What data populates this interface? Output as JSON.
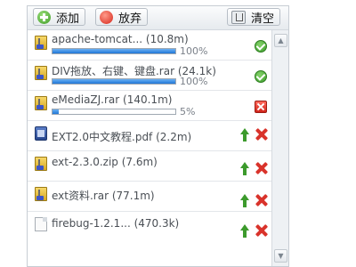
{
  "toolbar": {
    "add_label": "添加",
    "abandon_label": "放弃",
    "clear_label": "清空"
  },
  "files": [
    {
      "name": "apache-tomcat... (10.8m)",
      "type": "zip",
      "progress": 100,
      "percent_text": "100%",
      "status": "complete"
    },
    {
      "name": "DIV拖放、右键、键盘.rar (24.1k)",
      "type": "zip",
      "progress": 100,
      "percent_text": "100%",
      "status": "complete"
    },
    {
      "name": "eMediaZJ.rar (140.1m)",
      "type": "zip",
      "progress": 5,
      "percent_text": "5%",
      "status": "error"
    },
    {
      "name": "EXT2.0中文教程.pdf (2.2m)",
      "type": "pdf",
      "status": "queued"
    },
    {
      "name": "ext-2.3.0.zip (7.6m)",
      "type": "zip",
      "status": "queued"
    },
    {
      "name": "ext资料.rar (77.1m)",
      "type": "zip",
      "status": "queued"
    },
    {
      "name": "firebug-1.2.1... (470.3k)",
      "type": "file",
      "status": "queued"
    }
  ],
  "icons": {
    "complete": "check-circle-icon",
    "error": "error-icon",
    "upload": "upload-arrow-icon",
    "remove": "delete-x-icon"
  },
  "colors": {
    "progress": "#1f76d6",
    "ok": "#3a9b2a",
    "error": "#d1241a"
  }
}
